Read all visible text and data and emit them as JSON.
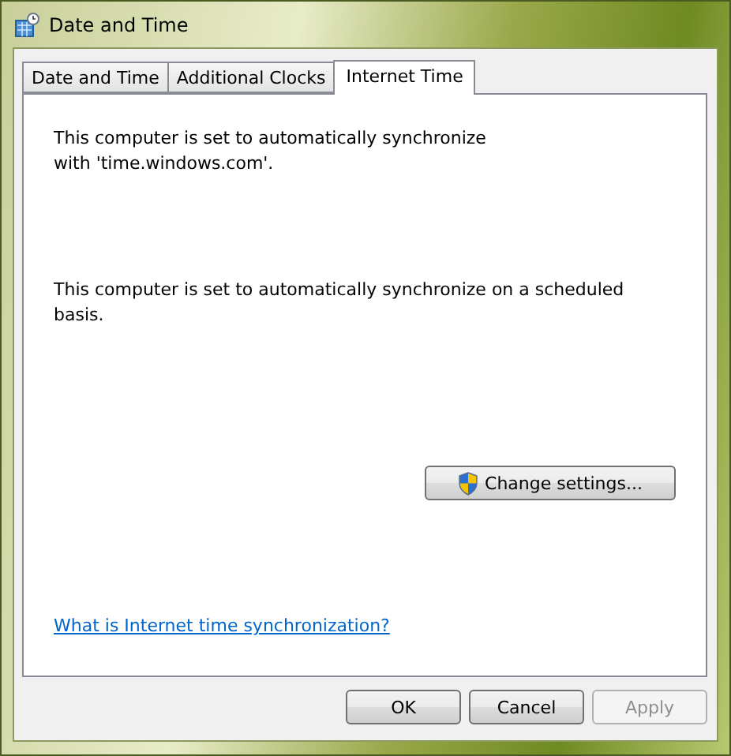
{
  "window": {
    "title": "Date and Time"
  },
  "tabs": [
    {
      "label": "Date and Time",
      "selected": false
    },
    {
      "label": "Additional Clocks",
      "selected": false
    },
    {
      "label": "Internet Time",
      "selected": true
    }
  ],
  "content": {
    "sync_server_text": "This computer is set to automatically synchronize with 'time.windows.com'.",
    "schedule_text": "This computer is set to automatically synchronize on a scheduled basis.",
    "change_button": "Change settings...",
    "help_link": "What is Internet time synchronization?"
  },
  "buttons": [
    {
      "label": "OK",
      "disabled": false
    },
    {
      "label": "Cancel",
      "disabled": false
    },
    {
      "label": "Apply",
      "disabled": true
    }
  ]
}
